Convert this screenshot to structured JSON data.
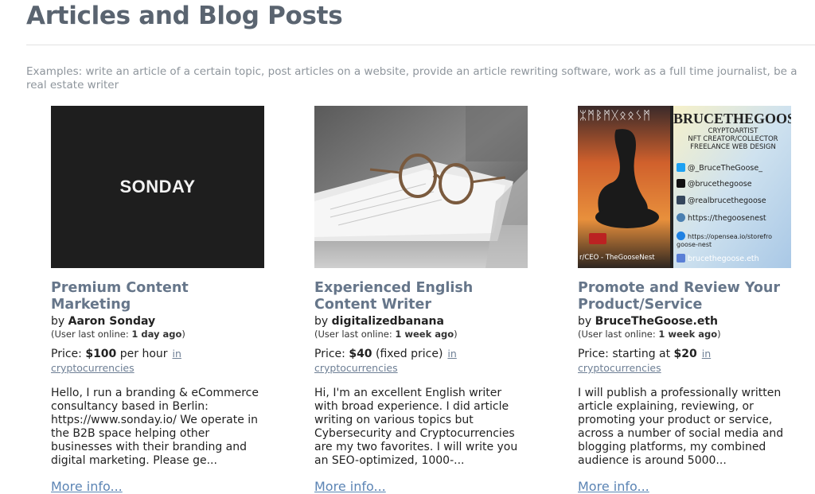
{
  "page": {
    "title": "Articles and Blog Posts",
    "examples": "Examples: write an article of a certain topic, post articles on a website, provide an article rewriting software, work as a full time journalist, be a real estate writer"
  },
  "cards": [
    {
      "image_text": "SONDAY",
      "title": "Premium Content Marketing",
      "by": "by",
      "author": "Aaron Sonday",
      "online_prefix": "(User last online: ",
      "online_value": "1 day ago",
      "online_suffix": ")",
      "price_prefix": "Price: ",
      "price_value": "$100",
      "price_suffix": " per hour",
      "category": "in cryptocurrencies",
      "description": "Hello, I run a branding & eCommerce consultancy based in Berlin: https://www.sonday.io/ We operate in the B2B space helping other businesses with their branding and digital marketing. Please ge...",
      "more": "More info..."
    },
    {
      "title": "Experienced English Content Writer",
      "by": "by",
      "author": "digitalizedbanana",
      "online_prefix": "(User last online: ",
      "online_value": "1 week ago",
      "online_suffix": ")",
      "price_prefix": "Price: ",
      "price_value": "$40",
      "price_suffix": " (fixed price)",
      "category": "in cryptocurrencies",
      "description": "Hi, I'm an excellent English writer with broad experience. I did article writing on various topics but Cybersecurity and Cryptocurrencies are my two favorites. I will write you an SEO-optimized, 1000-...",
      "more": "More info..."
    },
    {
      "image_runes": "ᛯᛗᛒᛗᚷᛟᛟᛊᛗ",
      "image_name": "BRUCETHEGOOSE",
      "image_sub1": "CRYPTOARTIST",
      "image_sub2": "NFT CREATOR/COLLECTOR",
      "image_sub3": "FREELANCE WEB DESIGN",
      "image_links": [
        "@_BruceTheGoose_",
        "@brucethegoose",
        "@realbrucethegoose",
        "https://thegoosenest",
        "https://opensea.io/storefro goose-nest",
        "brucethegoose.eth"
      ],
      "image_foot": "r/CEO - TheGooseNest",
      "title": "Promote and Review Your Product/Service",
      "by": "by",
      "author": "BruceTheGoose.eth",
      "online_prefix": "(User last online: ",
      "online_value": "1 week ago",
      "online_suffix": ")",
      "price_prefix": "Price: starting at ",
      "price_value": "$20",
      "price_suffix": "",
      "category": "in cryptocurrencies",
      "description": "I will publish a professionally written article explaining, reviewing, or promoting your product or service, across a number of social media and blogging platforms, my combined audience is around 5000...",
      "more": "More info..."
    }
  ],
  "colors": {
    "title": "#5a6470",
    "card_title": "#66768a",
    "link": "#5b84b4",
    "muted": "#8e959c"
  }
}
